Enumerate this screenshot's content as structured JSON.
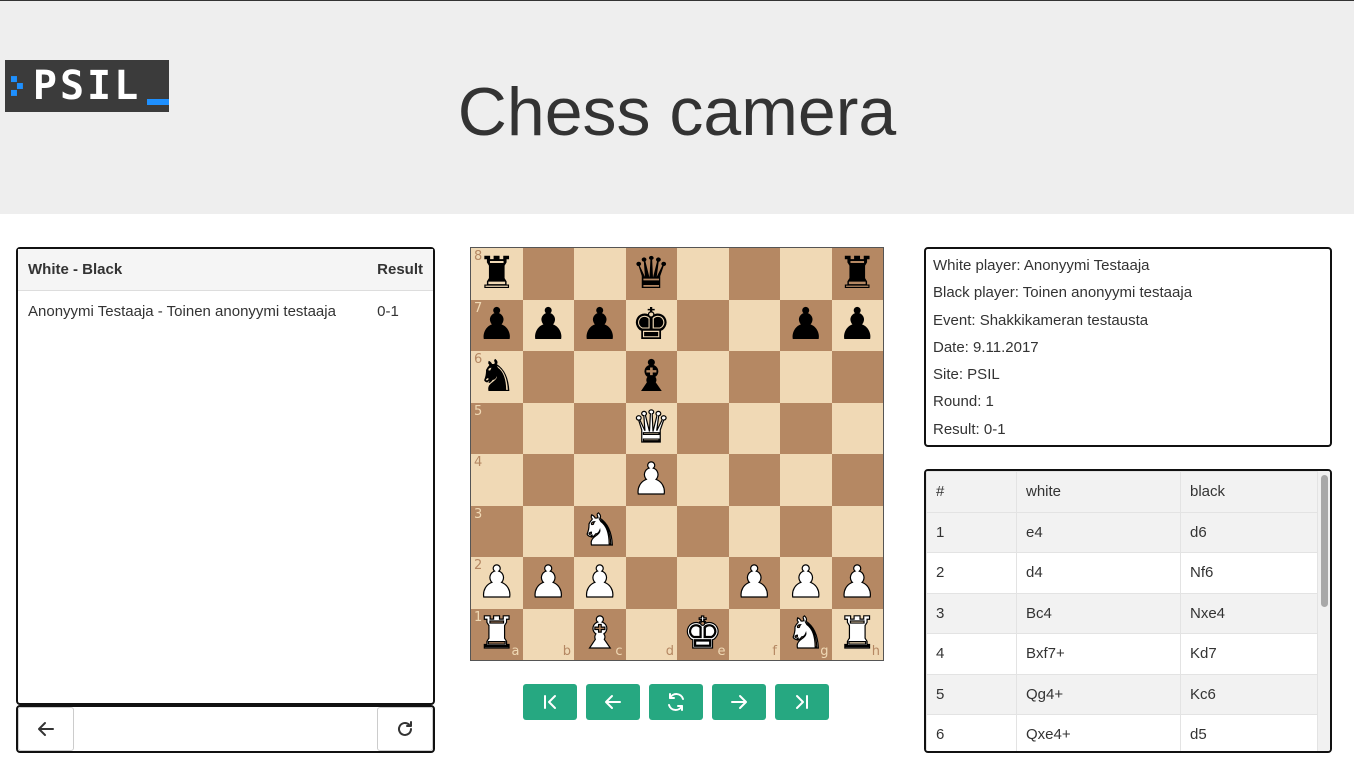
{
  "header": {
    "logo_text": "PSIL",
    "title": "Chess camera"
  },
  "games": {
    "col_players": "White - Black",
    "col_result": "Result",
    "rows": [
      {
        "players": "Anonyymi Testaaja - Toinen anonyymi testaaja",
        "result": "0-1"
      }
    ],
    "back_icon": "arrow-left-icon",
    "refresh_icon": "refresh-icon"
  },
  "board": {
    "position": [
      [
        "bR",
        "",
        "",
        "bQ",
        "",
        "",
        "",
        "bR"
      ],
      [
        "bP",
        "bP",
        "bP",
        "bK",
        "",
        "",
        "bP",
        "bP"
      ],
      [
        "bN",
        "",
        "",
        "bB",
        "",
        "",
        "",
        ""
      ],
      [
        "",
        "",
        "",
        "wQ",
        "",
        "",
        "",
        ""
      ],
      [
        "",
        "",
        "",
        "wP",
        "",
        "",
        "",
        ""
      ],
      [
        "",
        "",
        "wN",
        "",
        "",
        "",
        "",
        ""
      ],
      [
        "wP",
        "wP",
        "wP",
        "",
        "",
        "wP",
        "wP",
        "wP"
      ],
      [
        "wR",
        "",
        "wB",
        "",
        "wK",
        "",
        "wN",
        "wR"
      ]
    ],
    "ranks": [
      "8",
      "7",
      "6",
      "5",
      "4",
      "3",
      "2",
      "1"
    ],
    "files": [
      "a",
      "b",
      "c",
      "d",
      "e",
      "f",
      "g",
      "h"
    ],
    "light_color": "#f0d9b5",
    "dark_color": "#b58863"
  },
  "controls": {
    "first_icon": "skip-to-start-icon",
    "prev_icon": "arrow-left-icon",
    "flip_icon": "flip-board-icon",
    "next_icon": "arrow-right-icon",
    "last_icon": "skip-to-end-icon",
    "color": "#26a881"
  },
  "info": {
    "white": "White player: Anonyymi Testaaja",
    "black": "Black player: Toinen anonyymi testaaja",
    "event": "Event: Shakkikameran testausta",
    "date": "Date: 9.11.2017",
    "site": "Site: PSIL",
    "round": "Round: 1",
    "result": "Result: 0-1"
  },
  "moves": {
    "col_num": "#",
    "col_white": "white",
    "col_black": "black",
    "rows": [
      {
        "n": "1",
        "w": "e4",
        "b": "d6"
      },
      {
        "n": "2",
        "w": "d4",
        "b": "Nf6"
      },
      {
        "n": "3",
        "w": "Bc4",
        "b": "Nxe4"
      },
      {
        "n": "4",
        "w": "Bxf7+",
        "b": "Kd7"
      },
      {
        "n": "5",
        "w": "Qg4+",
        "b": "Kc6"
      },
      {
        "n": "6",
        "w": "Qxe4+",
        "b": "d5"
      }
    ]
  }
}
